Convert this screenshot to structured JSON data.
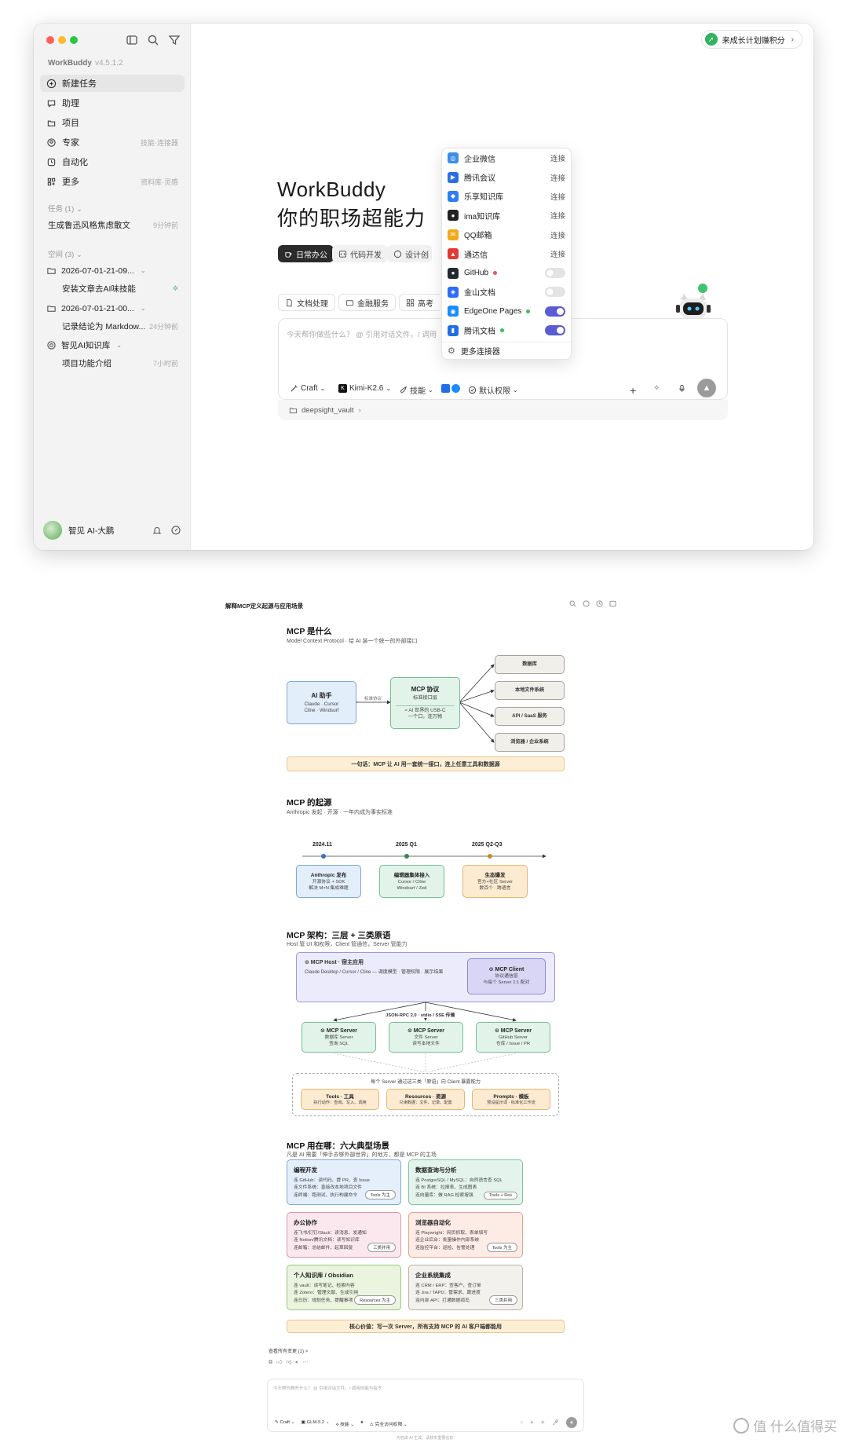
{
  "app": {
    "name": "WorkBuddy",
    "version": "v4.5.1.2",
    "nav": [
      {
        "label": "新建任务",
        "hint": "",
        "icon": "plus-circle-icon"
      },
      {
        "label": "助理",
        "hint": "",
        "icon": "chat-icon"
      },
      {
        "label": "项目",
        "hint": "",
        "icon": "folder-stack-icon"
      },
      {
        "label": "专家",
        "hint": "技能·连接器",
        "icon": "expert-icon"
      },
      {
        "label": "自动化",
        "hint": "",
        "icon": "clock-icon"
      },
      {
        "label": "更多",
        "hint": "资料库·灵感",
        "icon": "grid-icon"
      }
    ],
    "tasks_header": "任务 (1)",
    "tasks": [
      {
        "label": "生成鲁迅风格焦虑散文",
        "time": "9分钟前"
      }
    ],
    "spaces_header": "空间 (3)",
    "spaces": [
      {
        "label": "2026-07-01-21-09...",
        "child": "安装文章去AI味技能",
        "child_time": ""
      },
      {
        "label": "2026-07-01-21-00...",
        "child": "记录结论为 Markdow...",
        "child_time": "24分钟前"
      },
      {
        "label": "智见AI知识库",
        "child": "项目功能介绍",
        "child_time": "7小时前"
      }
    ],
    "user": {
      "name": "智见 AI-大鹏"
    },
    "promo": "来成长计划赚积分",
    "hero_title": "WorkBuddy",
    "hero_sub": "你的职场超能力",
    "tabs": [
      "日常办公",
      "代码开发",
      "设计创"
    ],
    "chips": [
      "文档处理",
      "金融服务",
      "高考"
    ],
    "composer": {
      "placeholder": "今天帮你做些什么？ @ 引用对话文件，/ 调用",
      "mode": "Craft",
      "model": "Kimi-K2.6",
      "skills": "技能",
      "permission": "默认权限",
      "path": "deepsight_vault"
    },
    "connectors": [
      {
        "name": "企业微信",
        "action": "连接",
        "color": "#3a8ee6",
        "icon": "wecom-icon"
      },
      {
        "name": "腾讯会议",
        "action": "连接",
        "color": "#2c6ee8",
        "icon": "tencent-meeting-icon"
      },
      {
        "name": "乐享知识库",
        "action": "连接",
        "color": "#2f7ef5",
        "icon": "lexiang-icon"
      },
      {
        "name": "ima知识库",
        "action": "连接",
        "color": "#222222",
        "icon": "ima-icon"
      },
      {
        "name": "QQ邮箱",
        "action": "连接",
        "color": "#f2a91c",
        "icon": "qq-mail-icon"
      },
      {
        "name": "通达信",
        "action": "连接",
        "color": "#e53935",
        "icon": "tdx-icon"
      },
      {
        "name": "GitHub",
        "action": "",
        "color": "#24292f",
        "icon": "github-icon",
        "dot": "#e4576b",
        "toggle": false
      },
      {
        "name": "金山文档",
        "action": "",
        "color": "#2e6cf6",
        "icon": "kdocs-icon",
        "toggle": false
      },
      {
        "name": "EdgeOne Pages",
        "action": "",
        "color": "#1a8cff",
        "icon": "edgeone-icon",
        "dot": "#3cbf5a",
        "toggle": true
      },
      {
        "name": "腾讯文档",
        "action": "",
        "color": "#1f6fe6",
        "icon": "tencent-docs-icon",
        "dot": "#3cbf5a",
        "toggle": true
      }
    ],
    "more_connectors": "更多连接器"
  },
  "doc": {
    "title": "解释MCP定义起源与应用场景",
    "s1": {
      "h": "MCP 是什么",
      "sub": "Model Context Protocol · 给 AI 装一个统一的外部接口",
      "assistant": {
        "t": "AI 助手",
        "s1": "Claude · Cursor",
        "s2": "Cline · Windsurf"
      },
      "edge": "标准协议",
      "protocol": {
        "t": "MCP 协议",
        "s": "标准接口层",
        "n1": "≈ AI 世界的 USB-C",
        "n2": "一个口，连万物"
      },
      "targets": [
        "数据库",
        "本地文件系统",
        "API / SaaS 服务",
        "浏览器 / 企业系统"
      ],
      "banner": "一句话：MCP 让 AI 用一套统一接口，连上任意工具和数据源"
    },
    "s2": {
      "h": "MCP 的起源",
      "sub": "Anthropic 发起 · 开源 · 一年内成为事实标准",
      "dates": [
        "2024.11",
        "2025 Q1",
        "2025 Q2-Q3"
      ],
      "boxes": [
        {
          "t": "Anthropic 发布",
          "l1": "开源协议 + SDK",
          "l2": "解决 M×N 集成难题"
        },
        {
          "t": "编辑器集体接入",
          "l1": "Cursor / Cline",
          "l2": "Windsurf / Zed"
        },
        {
          "t": "生态爆发",
          "l1": "官方+社区 Server",
          "l2": "数百个 · 跨语言"
        }
      ]
    },
    "s3": {
      "h": "MCP 架构：三层 + 三类原语",
      "sub": "Host 管 UI 和权限，Client 管通信，Server 管能力",
      "host_t": "⊙ MCP Host · 宿主应用",
      "host_s": "Claude Desktop / Cursor / Cline — 调度模型 · 管理权限 · 展示结果",
      "client_t": "⊙ MCP Client",
      "client_s1": "协议通信层",
      "client_s2": "与每个 Server 1:1 配对",
      "rpc": "JSON-RPC 2.0 · stdio / SSE 传输",
      "servers": [
        {
          "t": "⊙ MCP Server",
          "l1": "数据库 Server",
          "l2": "查询 SQL"
        },
        {
          "t": "⊙ MCP Server",
          "l1": "文件 Server",
          "l2": "读写本地文件"
        },
        {
          "t": "⊙ MCP Server",
          "l1": "GitHub Server",
          "l2": "仓库 / Issue / PR"
        }
      ],
      "prim_title": "每个 Server 通过这三类「原语」向 Client 暴露能力",
      "prims": [
        {
          "t": "Tools · 工具",
          "s": "执行动作：查询、写入、调用"
        },
        {
          "t": "Resources · 资源",
          "s": "只读数据：文件、记录、配置"
        },
        {
          "t": "Prompts · 模板",
          "s": "预设提示词 · 标准化工作流"
        }
      ]
    },
    "s4": {
      "h": "MCP 用在哪：六大典型场景",
      "sub": "凡是 AI 需要「伸手去够外部世界」的地方，都是 MCP 的主场",
      "cards": [
        {
          "t": "编程开发",
          "l": [
            "连 GitHub：读代码、提 PR、查 Issue",
            "连文件系统：直接改本地项目文件",
            "连终端：跑测试、执行构建命令"
          ],
          "p": "Tools 为主",
          "bg": "#e5effb",
          "bd": "#7fa6d9"
        },
        {
          "t": "数据查询与分析",
          "l": [
            "连 PostgreSQL / MySQL：自然语言查 SQL",
            "连 BI 系统：拉报表、生成图表",
            "连向量库：做 RAG 检索增强"
          ],
          "p": "Tools + Res",
          "bg": "#e4f4ec",
          "bd": "#7cc39b"
        },
        {
          "t": "办公协作",
          "l": [
            "连飞书/钉钉/Slack：读消息、发通知",
            "连 Notion/腾讯文档：读写知识库",
            "连邮箱：总结邮件、起草回复"
          ],
          "p": "三类并用",
          "bg": "#fbe8ee",
          "bd": "#dd97aa"
        },
        {
          "t": "浏览器自动化",
          "l": [
            "连 Playwright：网页抓取、表单填写",
            "连企业后台：批量操作内部系统",
            "连监控平台：巡检、告警处理"
          ],
          "p": "Tools 为主",
          "bg": "#fdebe6",
          "bd": "#e3a292"
        },
        {
          "t": "个人知识库 / Obsidian",
          "l": [
            "连 vault：读写笔记、检索内容",
            "连 Zotero：管理文献、生成引用",
            "连日历：规划任务、提醒事项"
          ],
          "p": "Resources 为主",
          "bg": "#eaf4df",
          "bd": "#9cc67d"
        },
        {
          "t": "企业系统集成",
          "l": [
            "连 CRM / ERP：查客户、查订单",
            "连 Jira / TAPD：管需求、跟进度",
            "连内部 API：打通数据孤岛"
          ],
          "p": "三类并用",
          "bg": "#f3f1ed",
          "bd": "#b8b1a4"
        }
      ],
      "banner": "核心价值：写一次 Server，所有支持 MCP 的 AI 客户端都能用"
    },
    "footer": {
      "changes": "查看所有变更 (1) >",
      "placeholder": "今天帮你做些什么？ @ 引用对话文件，/ 调用技能与指令",
      "mode": "Craft",
      "model": "GLM-5.2",
      "skills": "技能",
      "permission": "完全访问权限",
      "disclaimer": "内容由 AI 生成，请核实重要信息"
    }
  },
  "watermark": "值 什么值得买"
}
